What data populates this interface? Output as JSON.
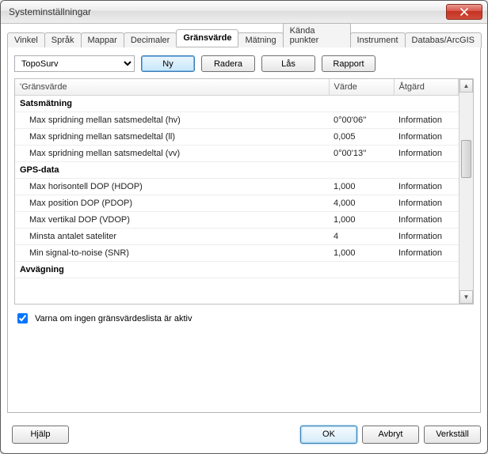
{
  "window": {
    "title": "Systeminställningar"
  },
  "tabs": [
    "Vinkel",
    "Språk",
    "Mappar",
    "Decimaler",
    "Gränsvärde",
    "Mätning",
    "Kända punkter",
    "Instrument",
    "Databas/ArcGIS"
  ],
  "active_tab_index": 4,
  "combo": {
    "value": "TopoSurv"
  },
  "toolbar_buttons": {
    "ny": "Ny",
    "radera": "Radera",
    "las": "Lås",
    "rapport": "Rapport"
  },
  "table": {
    "headers": [
      "'Gränsvärde",
      "Värde",
      "Åtgärd"
    ],
    "groups": [
      {
        "name": "Satsmätning",
        "rows": [
          {
            "label": "Max spridning mellan satsmedeltal (hv)",
            "value": "0°00'06''",
            "action": "Information"
          },
          {
            "label": "Max spridning mellan satsmedeltal (ll)",
            "value": "0,005",
            "action": "Information"
          },
          {
            "label": "Max spridning mellan satsmedeltal (vv)",
            "value": "0°00'13''",
            "action": "Information"
          }
        ]
      },
      {
        "name": "GPS-data",
        "rows": [
          {
            "label": "Max horisontell DOP (HDOP)",
            "value": "1,000",
            "action": "Information"
          },
          {
            "label": "Max position DOP (PDOP)",
            "value": "4,000",
            "action": "Information"
          },
          {
            "label": "Max vertikal DOP (VDOP)",
            "value": "1,000",
            "action": "Information"
          },
          {
            "label": "Minsta antalet sateliter",
            "value": "4",
            "action": "Information"
          },
          {
            "label": "Min signal-to-noise (SNR)",
            "value": "1,000",
            "action": "Information"
          }
        ]
      },
      {
        "name": "Avvägning",
        "rows": []
      }
    ]
  },
  "checkbox": {
    "label": "Varna om ingen gränsvärdeslista är aktiv",
    "checked": true
  },
  "bottom": {
    "help": "Hjälp",
    "ok": "OK",
    "cancel": "Avbryt",
    "apply": "Verkställ"
  }
}
